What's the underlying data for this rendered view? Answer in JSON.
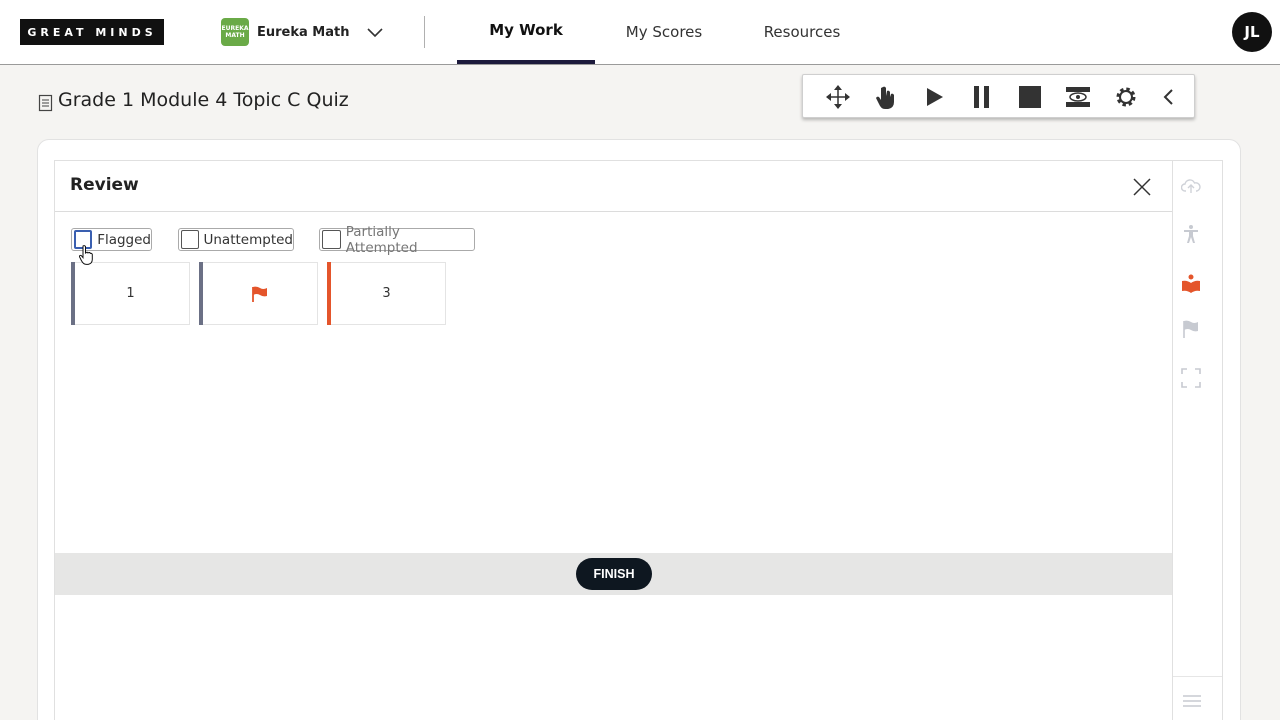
{
  "header": {
    "logo_text": "GREAT MINDS",
    "product": {
      "name": "Eureka Math",
      "icon_text": "EUREKA MATH",
      "icon_color": "#6aaa47"
    },
    "nav": [
      {
        "label": "My Work",
        "active": true
      },
      {
        "label": "My Scores",
        "active": false
      },
      {
        "label": "Resources",
        "active": false
      }
    ],
    "avatar_initials": "JL"
  },
  "page": {
    "title": "Grade 1 Module 4 Topic C Quiz"
  },
  "toolbar": {
    "buttons": [
      "move-icon",
      "pointer-hand-icon",
      "play-icon",
      "pause-icon",
      "stop-icon",
      "reading-mask-icon",
      "settings-gear-icon",
      "collapse-chevron-left-icon"
    ]
  },
  "review": {
    "title": "Review",
    "filters": [
      {
        "label": "Flagged",
        "checked": false
      },
      {
        "label": "Unattempted",
        "checked": false
      },
      {
        "label": "Partially Attempted",
        "checked": false
      }
    ],
    "questions": [
      {
        "label": "1",
        "flagged": false,
        "current": false
      },
      {
        "label": "",
        "flagged": true,
        "current": false
      },
      {
        "label": "3",
        "flagged": false,
        "current": true
      }
    ],
    "finish_label": "FINISH"
  },
  "side_rail": {
    "buttons": [
      "cloud-upload-icon",
      "accessibility-icon",
      "reader-icon",
      "flag-icon",
      "fullscreen-icon"
    ],
    "active_color": "#e4552b"
  },
  "colors": {
    "accent": "#e4552b",
    "nav_underline": "#1c1a3c",
    "finish_button": "#0e1720"
  }
}
